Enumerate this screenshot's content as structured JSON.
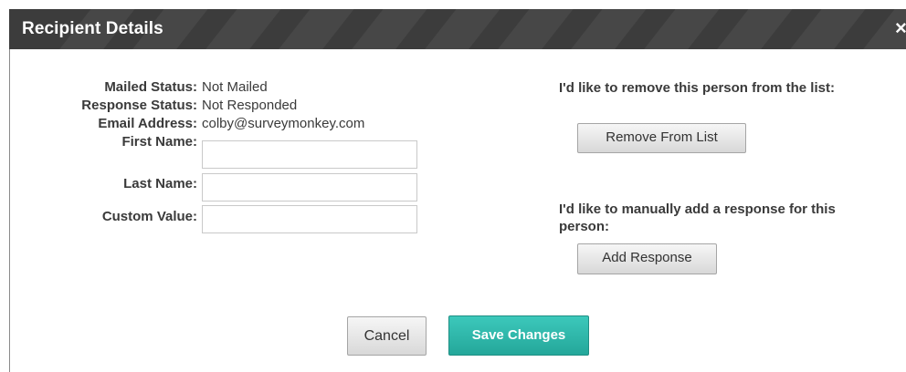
{
  "dialog": {
    "title": "Recipient Details",
    "close_glyph": "×"
  },
  "details": {
    "mailed_status_label": "Mailed Status:",
    "mailed_status_value": "Not Mailed",
    "response_status_label": "Response Status:",
    "response_status_value": "Not Responded",
    "email_label": "Email Address:",
    "email_value": "colby@surveymonkey.com",
    "first_name_label": "First Name:",
    "first_name_value": "",
    "last_name_label": "Last Name:",
    "last_name_value": "",
    "custom_value_label": "Custom Value:",
    "custom_value_value": ""
  },
  "actions": {
    "remove_note": "I'd like to remove this person from the list:",
    "remove_button": "Remove From List",
    "add_note": "I'd like to manually add a response for this person:",
    "add_button": "Add Response"
  },
  "footer": {
    "cancel_button": "Cancel",
    "save_button": "Save Changes"
  },
  "colors": {
    "titlebar": "#3c3c3c",
    "primary": "#2fb8ab"
  },
  "icons": {
    "close": "close-icon"
  }
}
